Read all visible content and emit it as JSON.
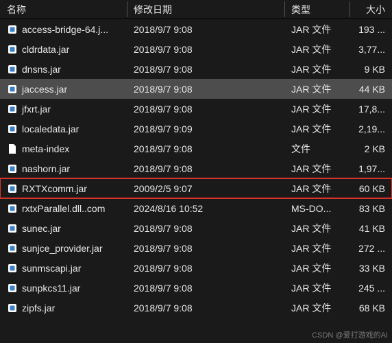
{
  "header": {
    "name": "名称",
    "modified": "修改日期",
    "type": "类型",
    "size": "大小"
  },
  "rows": [
    {
      "icon": "jar",
      "name": "access-bridge-64.j...",
      "modified": "2018/9/7 9:08",
      "type": "JAR 文件",
      "size": "193 ...",
      "selected": false,
      "highlight": false
    },
    {
      "icon": "jar",
      "name": "cldrdata.jar",
      "modified": "2018/9/7 9:08",
      "type": "JAR 文件",
      "size": "3,77...",
      "selected": false,
      "highlight": false
    },
    {
      "icon": "jar",
      "name": "dnsns.jar",
      "modified": "2018/9/7 9:08",
      "type": "JAR 文件",
      "size": "9 KB",
      "selected": false,
      "highlight": false
    },
    {
      "icon": "jar",
      "name": "jaccess.jar",
      "modified": "2018/9/7 9:08",
      "type": "JAR 文件",
      "size": "44 KB",
      "selected": true,
      "highlight": false
    },
    {
      "icon": "jar",
      "name": "jfxrt.jar",
      "modified": "2018/9/7 9:08",
      "type": "JAR 文件",
      "size": "17,8...",
      "selected": false,
      "highlight": false
    },
    {
      "icon": "jar",
      "name": "localedata.jar",
      "modified": "2018/9/7 9:09",
      "type": "JAR 文件",
      "size": "2,19...",
      "selected": false,
      "highlight": false
    },
    {
      "icon": "file",
      "name": "meta-index",
      "modified": "2018/9/7 9:08",
      "type": "文件",
      "size": "2 KB",
      "selected": false,
      "highlight": false
    },
    {
      "icon": "jar",
      "name": "nashorn.jar",
      "modified": "2018/9/7 9:08",
      "type": "JAR 文件",
      "size": "1,97...",
      "selected": false,
      "highlight": false
    },
    {
      "icon": "jar",
      "name": "RXTXcomm.jar",
      "modified": "2009/2/5 9:07",
      "type": "JAR 文件",
      "size": "60 KB",
      "selected": false,
      "highlight": true
    },
    {
      "icon": "jar",
      "name": "rxtxParallel.dll..com",
      "modified": "2024/8/16 10:52",
      "type": "MS-DO...",
      "size": "83 KB",
      "selected": false,
      "highlight": false
    },
    {
      "icon": "jar",
      "name": "sunec.jar",
      "modified": "2018/9/7 9:08",
      "type": "JAR 文件",
      "size": "41 KB",
      "selected": false,
      "highlight": false
    },
    {
      "icon": "jar",
      "name": "sunjce_provider.jar",
      "modified": "2018/9/7 9:08",
      "type": "JAR 文件",
      "size": "272 ...",
      "selected": false,
      "highlight": false
    },
    {
      "icon": "jar",
      "name": "sunmscapi.jar",
      "modified": "2018/9/7 9:08",
      "type": "JAR 文件",
      "size": "33 KB",
      "selected": false,
      "highlight": false
    },
    {
      "icon": "jar",
      "name": "sunpkcs11.jar",
      "modified": "2018/9/7 9:08",
      "type": "JAR 文件",
      "size": "245 ...",
      "selected": false,
      "highlight": false
    },
    {
      "icon": "jar",
      "name": "zipfs.jar",
      "modified": "2018/9/7 9:08",
      "type": "JAR 文件",
      "size": "68 KB",
      "selected": false,
      "highlight": false
    }
  ],
  "watermark": "CSDN @爱打游戏的AI"
}
